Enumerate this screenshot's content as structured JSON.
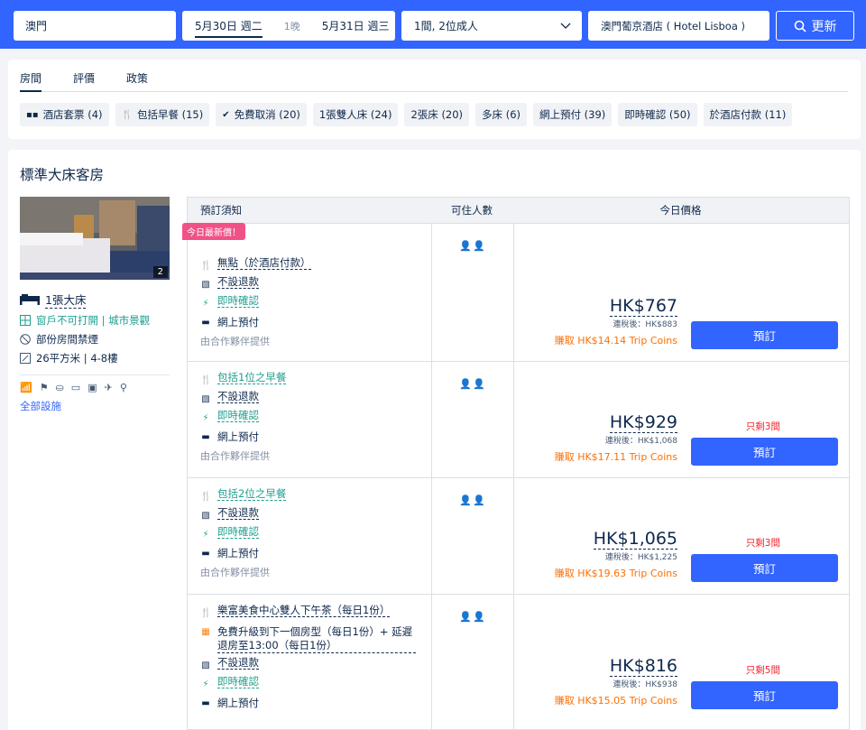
{
  "search": {
    "destination": "澳門",
    "checkin": "5月30日 週二",
    "nights": "1晚",
    "checkout": "5月31日 週三",
    "guests": "1間, 2位成人",
    "hotel": "澳門葡京酒店 ( Hotel Lisboa )",
    "button": "更新"
  },
  "tabs": [
    "房間",
    "評價",
    "政策"
  ],
  "chips": [
    "酒店套票 (4)",
    "包括早餐 (15)",
    "免費取消 (20)",
    "1張雙人床 (24)",
    "2張床 (20)",
    "多床 (6)",
    "網上預付 (39)",
    "即時確認 (50)",
    "於酒店付款 (11)"
  ],
  "room": {
    "title": "標準大床客房",
    "photo_count": "2",
    "bed": "1張大床",
    "window": "窗戶不可打開 | 城市景觀",
    "smoking": "部份房間禁煙",
    "size": "26平方米 | 4-8樓",
    "all_facilities": "全部設施"
  },
  "table_header": {
    "col1": "預訂須知",
    "col2": "可住人數",
    "col3": "今日價格"
  },
  "offers": [
    {
      "badge": "今日最新價！",
      "features": [
        "無點（於酒店付款）",
        "不設退款",
        "即時確認",
        "網上預付"
      ],
      "partner": "由合作夥伴提供",
      "price": "HK$767",
      "tax": "連稅後：HK$883",
      "coins": "賺取 HK$14.14 Trip Coins",
      "left": "",
      "book": "預訂"
    },
    {
      "features": [
        "包括1位之早餐",
        "不設退款",
        "即時確認",
        "網上預付"
      ],
      "partner": "由合作夥伴提供",
      "price": "HK$929",
      "tax": "連稅後：HK$1,068",
      "coins": "賺取 HK$17.11 Trip Coins",
      "left": "只剩3間",
      "book": "預訂"
    },
    {
      "features": [
        "包括2位之早餐",
        "不設退款",
        "即時確認",
        "網上預付"
      ],
      "partner": "由合作夥伴提供",
      "price": "HK$1,065",
      "tax": "連稅後：HK$1,225",
      "coins": "賺取 HK$19.63 Trip Coins",
      "left": "只剩3間",
      "book": "預訂"
    },
    {
      "features": [
        "樂富美食中心雙人下午茶（每日1份）",
        "免費升級到下一個房型（每日1份）+ 延遲退房至13:00（每日1份）",
        "不設退款",
        "即時確認",
        "網上預付"
      ],
      "price": "HK$816",
      "tax": "連稅後：HK$938",
      "coins": "賺取 HK$15.05 Trip Coins",
      "left": "只剩5間",
      "book": "預訂"
    }
  ],
  "colors": {
    "brand": "#3264ff",
    "orange": "#ff6f00",
    "teal": "#1e9f8e",
    "badge": "#f05287"
  }
}
